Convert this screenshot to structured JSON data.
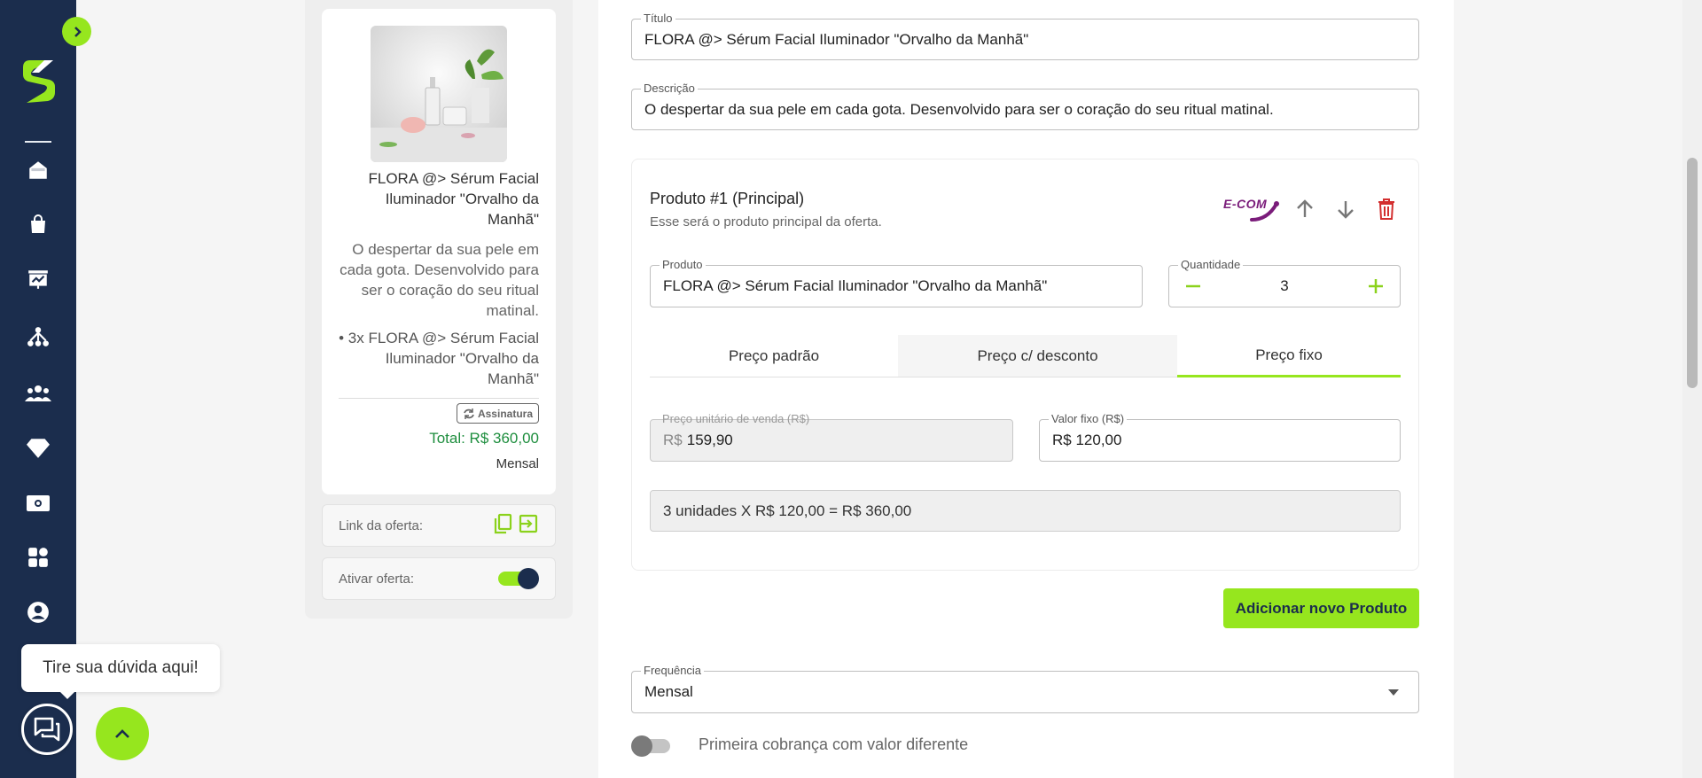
{
  "preview": {
    "title": "FLORA @> Sérum Facial Iluminador \"Orvalho da Manhã\"",
    "description": "O despertar da sua pele em cada gota. Desenvolvido para ser o coração do seu ritual matinal.",
    "items": "• 3x FLORA @> Sérum Facial Iluminador \"Orvalho da Manhã\"",
    "badge": "Assinatura",
    "total": "Total: R$ 360,00",
    "frequency": "Mensal",
    "link_label": "Link da oferta:",
    "activate_label": "Ativar oferta:",
    "activate_on": true
  },
  "form": {
    "title_label": "Título",
    "title_value": "FLORA @> Sérum Facial Iluminador \"Orvalho da Manhã\"",
    "description_label": "Descrição",
    "description_value": "O despertar da sua pele em cada gota. Desenvolvido para ser o coração do seu ritual matinal.",
    "product": {
      "heading": "Produto #1 (Principal)",
      "subheading": "Esse será o produto principal da oferta.",
      "ecom_logo": "E-COM",
      "product_label": "Produto",
      "product_value": "FLORA @> Sérum Facial Iluminador \"Orvalho da Manhã\"",
      "quantity_label": "Quantidade",
      "quantity_value": "3",
      "tabs": [
        "Preço padrão",
        "Preço c/ desconto",
        "Preço fixo"
      ],
      "active_tab": 2,
      "unit_price_label": "Preço unitário de venda (R$)",
      "unit_price_prefix": "R$",
      "unit_price_value": "159,90",
      "fixed_value_label": "Valor fixo (R$)",
      "fixed_value": "R$ 120,00",
      "summary": "3 unidades X R$ 120,00 = R$ 360,00"
    },
    "add_product_label": "Adicionar novo Produto",
    "frequency_label": "Frequência",
    "frequency_value": "Mensal",
    "first_charge_label": "Primeira cobrança com valor diferente",
    "first_charge_on": false
  },
  "chat": {
    "tooltip": "Tire sua dúvida aqui!"
  },
  "colors": {
    "sidebar": "#1b2d4d",
    "accent": "#96e61e",
    "total_green": "#1e8e3e",
    "danger": "#d32f2f",
    "ecom": "#7a1c7a"
  },
  "icons": {
    "sidebar": [
      "home-icon",
      "shopping-bag-icon",
      "dashboard-chart-icon",
      "network-icon",
      "users-icon",
      "diamond-icon",
      "money-icon",
      "apps-icon",
      "account-icon"
    ]
  }
}
